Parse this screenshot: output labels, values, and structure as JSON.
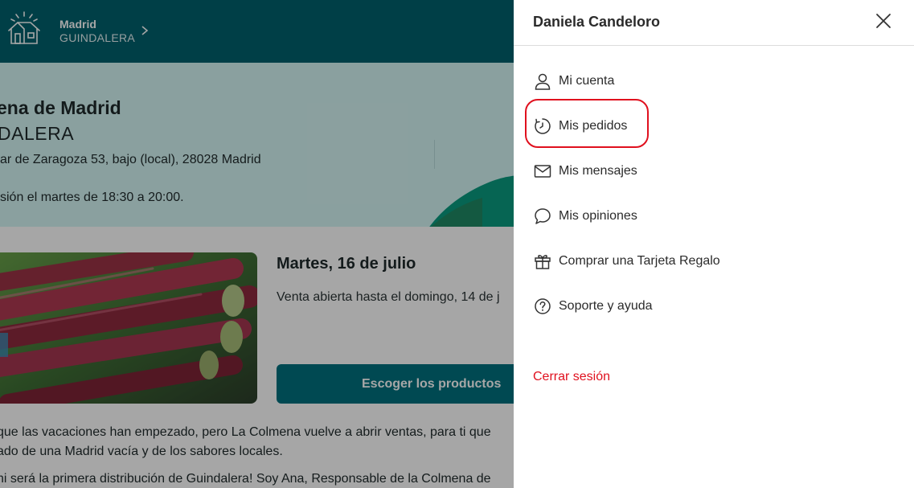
{
  "topbar": {
    "location_name": "Madrid",
    "location_sub": "GUINDALERA"
  },
  "hero": {
    "title": "ena de Madrid",
    "subtitle": "DALERA",
    "address": "ar de Zaragoza 53, bajo (local), 28028 Madrid",
    "distribution": "sión el martes de 18:30 a 20:00."
  },
  "sale": {
    "date": "Martes, 16 de julio",
    "open_until": "Venta abierta hasta el domingo, 14 de j",
    "choose_button": "Escoger los productos"
  },
  "body_text": {
    "line1": "que las vacaciones han empezado, pero La Colmena vuelve a abrir ventas, para ti que",
    "line2": "ado de una Madrid vacía y de los sabores locales.",
    "line3": "ni será la primera distribución de Guindalera! Soy Ana, Responsable de la Colmena de"
  },
  "panel": {
    "user_name": "Daniela Candeloro",
    "menu": [
      {
        "label": "Mi cuenta",
        "icon": "user-icon"
      },
      {
        "label": "Mis pedidos",
        "icon": "history-icon"
      },
      {
        "label": "Mis mensajes",
        "icon": "mail-icon"
      },
      {
        "label": "Mis opiniones",
        "icon": "comment-icon"
      },
      {
        "label": "Comprar una Tarjeta Regalo",
        "icon": "gift-icon"
      },
      {
        "label": "Soporte y ayuda",
        "icon": "help-icon"
      }
    ],
    "logout": "Cerrar sesión"
  },
  "colors": {
    "topbar": "#00616e",
    "hero_bg": "#d5f6f5",
    "button": "#00707e",
    "accent_red": "#e0101e"
  }
}
